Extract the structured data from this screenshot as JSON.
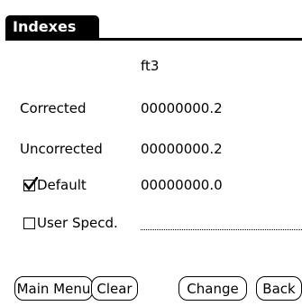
{
  "title": "Indexes",
  "unit_header": "ft3",
  "rows": [
    {
      "label": "Corrected",
      "value": "00000000.2"
    },
    {
      "label": "Uncorrected",
      "value": "00000000.2"
    }
  ],
  "default_option": {
    "label": "Default",
    "value": "00000000.0",
    "checked": true
  },
  "user_option": {
    "label": "User Specd.",
    "checked": false
  },
  "buttons": {
    "main_menu": "Main Menu",
    "clear": "Clear",
    "change": "Change",
    "back": "Back"
  }
}
